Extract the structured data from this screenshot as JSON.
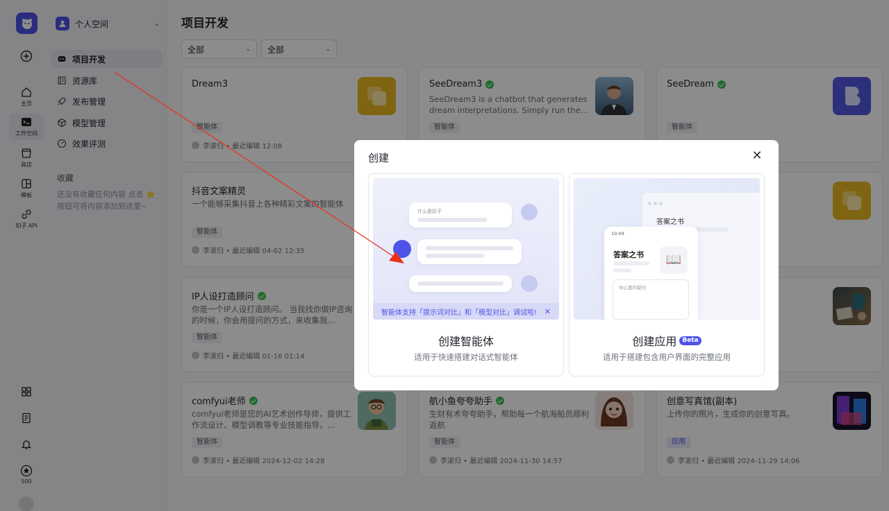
{
  "rail": {
    "items": [
      {
        "label": ""
      },
      {
        "label": "主页"
      },
      {
        "label": "工作空间"
      },
      {
        "label": "商店"
      },
      {
        "label": "模板"
      },
      {
        "label": "扣子 API"
      }
    ],
    "credits": "500"
  },
  "sidebar": {
    "workspace": "个人空间",
    "nav": [
      "项目开发",
      "资源库",
      "发布管理",
      "模型管理",
      "效果评测"
    ],
    "favorites_title": "收藏",
    "favorites_empty": "还没有收藏任何内容 点击 ⭐ 按钮可将内容添加到这里~"
  },
  "main": {
    "title": "项目开发",
    "filter1": "全部",
    "filter2": "全部"
  },
  "cards": [
    {
      "title": "Dream3",
      "desc": "",
      "tag": "智能体",
      "meta": "李滚归 • 最近编辑 12:08"
    },
    {
      "title": "SeeDream3",
      "desc": "SeeDream3 is a chatbot that generates dream interpretations. Simply run the...",
      "tag": "智能体",
      "meta": ""
    },
    {
      "title": "SeeDream",
      "desc": "",
      "tag": "智能体",
      "meta": ""
    },
    {
      "title": "抖音文案精灵",
      "desc": "一个能够采集抖音上各种精彩文案的智能体",
      "tag": "智能体",
      "meta": "李滚归 • 最近编辑 04-02 12:35"
    },
    {
      "title": "IP人设打造顾问",
      "desc": "你是一个IP人设打造顾问。 当我找你做IP咨询的时候，你会用提问的方式，来收集我...",
      "tag": "智能体",
      "meta": "李滚归 • 最近编辑 01-16 01:14"
    },
    {
      "title": "comfyui老师",
      "desc": "comfyui老师是您的AI艺术创作导师，提供工作流设计、模型调教等专业技能指导。...",
      "tag": "智能体",
      "meta": "李滚归 • 最近编辑 2024-12-02 14:28"
    },
    {
      "title": "航小鱼夸夸助手",
      "desc": "生财有术夸夸助手，帮助每一个航海船员顺利返航",
      "tag": "智能体",
      "meta": "李滚归 • 最近编辑 2024-11-30 14:57"
    },
    {
      "title": "创意写真馆(副本)",
      "desc": "上传你的照片，生成你的创意写真。",
      "tag": "应用",
      "meta": "李滚归 • 最近编辑 2024-11-29 14:06"
    }
  ],
  "modal": {
    "title": "创建",
    "close": "✕",
    "agent": {
      "title": "创建智能体",
      "sub": "适用于快速搭建对话式智能体",
      "bubble_text": "什么是扣子",
      "banner": "智能体支持「提示词对比」和「模型对比」调试啦!",
      "banner_close": "✕"
    },
    "app": {
      "title": "创建应用",
      "badge": "Beta",
      "sub": "适用于搭建包含用户界面的完整应用",
      "phone_time": "10:09",
      "book_title": "答案之书",
      "input_placeholder": "你心里的疑问",
      "book_emoji": "📖"
    }
  },
  "colors": {
    "accent": "#4d53e8",
    "verified": "#3ec254",
    "annotation_arrow": "#e8321f"
  }
}
